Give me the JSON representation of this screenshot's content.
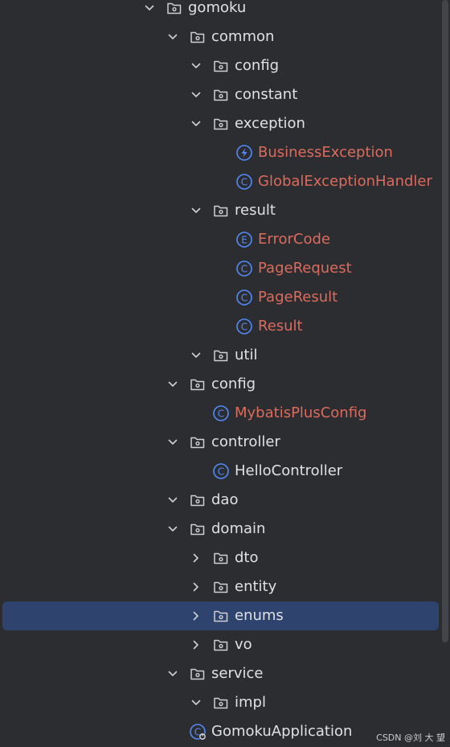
{
  "tree": [
    {
      "label": "gomoku",
      "kind": "folder",
      "depth": 0,
      "chevron": "down",
      "style": "norm"
    },
    {
      "label": "common",
      "kind": "folder",
      "depth": 1,
      "chevron": "down",
      "style": "norm"
    },
    {
      "label": "config",
      "kind": "folder",
      "depth": 2,
      "chevron": "down",
      "style": "norm"
    },
    {
      "label": "constant",
      "kind": "folder",
      "depth": 2,
      "chevron": "down",
      "style": "norm"
    },
    {
      "label": "exception",
      "kind": "folder",
      "depth": 2,
      "chevron": "down",
      "style": "norm"
    },
    {
      "label": "BusinessException",
      "kind": "exception-class",
      "depth": 3,
      "chevron": "none",
      "style": "err"
    },
    {
      "label": "GlobalExceptionHandler",
      "kind": "class",
      "depth": 3,
      "chevron": "none",
      "style": "err"
    },
    {
      "label": "result",
      "kind": "folder",
      "depth": 2,
      "chevron": "down",
      "style": "norm"
    },
    {
      "label": "ErrorCode",
      "kind": "enum",
      "depth": 3,
      "chevron": "none",
      "style": "err"
    },
    {
      "label": "PageRequest",
      "kind": "class",
      "depth": 3,
      "chevron": "none",
      "style": "err"
    },
    {
      "label": "PageResult",
      "kind": "class",
      "depth": 3,
      "chevron": "none",
      "style": "err"
    },
    {
      "label": "Result",
      "kind": "class",
      "depth": 3,
      "chevron": "none",
      "style": "err"
    },
    {
      "label": "util",
      "kind": "folder",
      "depth": 2,
      "chevron": "down",
      "style": "norm"
    },
    {
      "label": "config",
      "kind": "folder",
      "depth": 1,
      "chevron": "down",
      "style": "norm"
    },
    {
      "label": "MybatisPlusConfig",
      "kind": "class",
      "depth": 2,
      "chevron": "none",
      "style": "err"
    },
    {
      "label": "controller",
      "kind": "folder",
      "depth": 1,
      "chevron": "down",
      "style": "norm"
    },
    {
      "label": "HelloController",
      "kind": "class",
      "depth": 2,
      "chevron": "none",
      "style": "norm"
    },
    {
      "label": "dao",
      "kind": "folder",
      "depth": 1,
      "chevron": "down",
      "style": "norm"
    },
    {
      "label": "domain",
      "kind": "folder",
      "depth": 1,
      "chevron": "down",
      "style": "norm"
    },
    {
      "label": "dto",
      "kind": "folder",
      "depth": 2,
      "chevron": "right",
      "style": "norm"
    },
    {
      "label": "entity",
      "kind": "folder",
      "depth": 2,
      "chevron": "right",
      "style": "norm"
    },
    {
      "label": "enums",
      "kind": "folder",
      "depth": 2,
      "chevron": "right",
      "style": "norm",
      "selected": true
    },
    {
      "label": "vo",
      "kind": "folder",
      "depth": 2,
      "chevron": "right",
      "style": "norm"
    },
    {
      "label": "service",
      "kind": "folder",
      "depth": 1,
      "chevron": "down",
      "style": "norm"
    },
    {
      "label": "impl",
      "kind": "folder",
      "depth": 2,
      "chevron": "down",
      "style": "norm"
    },
    {
      "label": "GomokuApplication",
      "kind": "spring-app-class",
      "depth": 1,
      "chevron": "none",
      "style": "norm"
    }
  ],
  "colors": {
    "background": "#2b2d30",
    "selection": "#2e436e",
    "text": "#dfe1e5",
    "error_text": "#dc6b5e",
    "icon_blue": "#548af7",
    "folder_stroke": "#ced0d6"
  },
  "watermark": "CSDN @刘 大 望"
}
